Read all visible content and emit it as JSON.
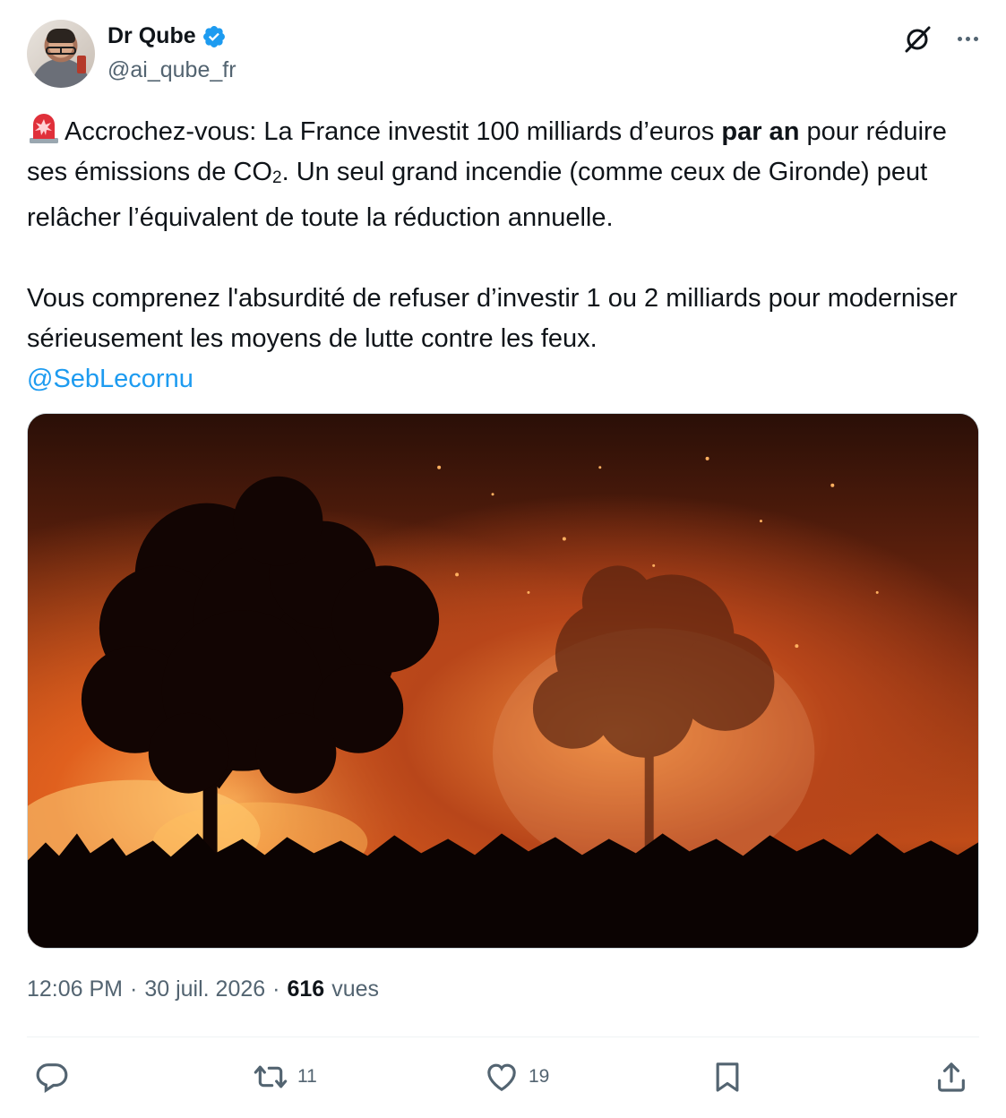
{
  "author": {
    "display_name": "Dr Qube",
    "handle": "@ai_qube_fr",
    "verified": true
  },
  "tweet": {
    "paragraph1": {
      "emoji": "rotating-light-emoji",
      "part1": "Accrochez-vous: La France investit 100 milliards d’euros ",
      "bold": "par an",
      "part2": " pour réduire ses émissions de CO",
      "subscript": "2",
      "part3": ".  Un seul grand incendie (comme ceux de Gironde) peut relâcher l’équivalent de toute la réduction annuelle."
    },
    "paragraph2": "Vous comprenez l'absurdité de refuser d’investir 1 ou 2 milliards pour moderniser sérieusement les moyens de lutte contre les feux.",
    "mention": "@SebLecornu"
  },
  "meta": {
    "time": "12:06 PM",
    "separator1": "·",
    "date": "30 juil. 2026",
    "separator2": "·",
    "views_count": "616",
    "views_label": "vues"
  },
  "actions": {
    "reply_count": "",
    "retweet_count": "11",
    "like_count": "19"
  },
  "icons": {
    "grok": "grok-icon",
    "more": "more-icon",
    "verified": "verified-badge-icon",
    "reply": "reply-icon",
    "retweet": "retweet-icon",
    "like": "heart-icon",
    "bookmark": "bookmark-icon",
    "share": "share-icon"
  },
  "colors": {
    "accent": "#1d9bf0",
    "text": "#0f1419",
    "secondary": "#536471"
  }
}
